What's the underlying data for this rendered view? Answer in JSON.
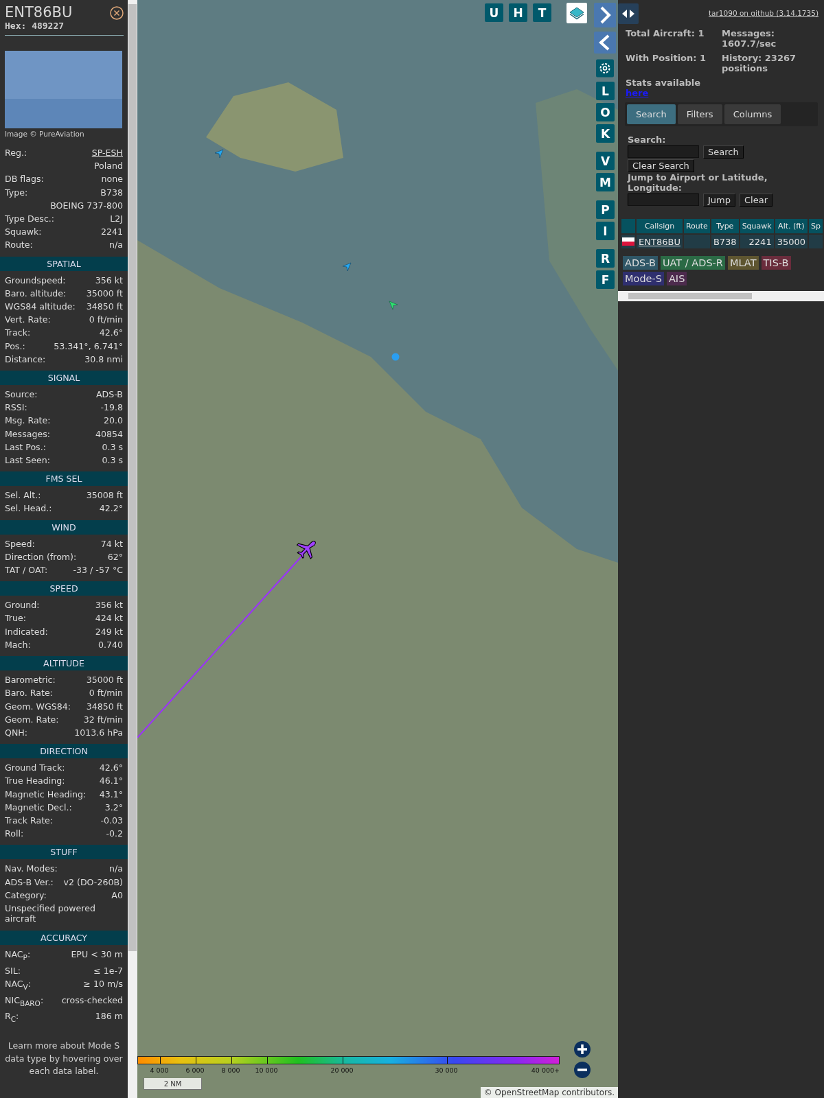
{
  "sidebar": {
    "callsign": "ENT86BU",
    "hex_label": "Hex:",
    "hex": "489227",
    "photo_credit": "Image © PureAviation",
    "summary": [
      {
        "kind": "link",
        "label": "Reg.:",
        "value": "SP-ESH"
      },
      {
        "kind": "value",
        "value": "Poland"
      },
      {
        "kind": "pair",
        "label": "DB flags:",
        "value": "none"
      },
      {
        "kind": "pair",
        "label": "Type:",
        "value": "B738"
      },
      {
        "kind": "value",
        "value": "BOEING 737-800"
      },
      {
        "kind": "pair",
        "label": "Type Desc.:",
        "value": "L2J"
      },
      {
        "kind": "pair",
        "label": "Squawk:",
        "value": "2241"
      },
      {
        "kind": "pair",
        "label": "Route:",
        "value": "n/a"
      }
    ],
    "sections": [
      {
        "title": "SPATIAL",
        "rows": [
          {
            "kind": "pair",
            "label": "Groundspeed:",
            "value": "356 kt"
          },
          {
            "kind": "pair",
            "label": "Baro. altitude:",
            "value": "35000 ft"
          },
          {
            "kind": "pair",
            "label": "WGS84 altitude:",
            "value": "34850 ft"
          },
          {
            "kind": "pair",
            "label": "Vert. Rate:",
            "value": "0 ft/min"
          },
          {
            "kind": "pair",
            "label": "Track:",
            "value": "42.6°"
          },
          {
            "kind": "pair",
            "label": "Pos.:",
            "value": "53.341°, 6.741°"
          },
          {
            "kind": "pair",
            "label": "Distance:",
            "value": "30.8 nmi"
          }
        ]
      },
      {
        "title": "SIGNAL",
        "rows": [
          {
            "kind": "pair",
            "label": "Source:",
            "value": "ADS-B"
          },
          {
            "kind": "pair",
            "label": "RSSI:",
            "value": "-19.8"
          },
          {
            "kind": "pair",
            "label": "Msg. Rate:",
            "value": "20.0"
          },
          {
            "kind": "pair",
            "label": "Messages:",
            "value": "40854"
          },
          {
            "kind": "pair",
            "label": "Last Pos.:",
            "value": "0.3 s"
          },
          {
            "kind": "pair",
            "label": "Last Seen:",
            "value": "0.3 s"
          }
        ]
      },
      {
        "title": "FMS SEL",
        "rows": [
          {
            "kind": "pair",
            "label": "Sel. Alt.:",
            "value": "35008 ft"
          },
          {
            "kind": "pair",
            "label": "Sel. Head.:",
            "value": "42.2°"
          }
        ]
      },
      {
        "title": "WIND",
        "rows": [
          {
            "kind": "pair",
            "label": "Speed:",
            "value": "74 kt"
          },
          {
            "kind": "pair",
            "label": "Direction (from):",
            "value": "62°"
          },
          {
            "kind": "pair",
            "label": "TAT / OAT:",
            "value": "-33 / -57 °C"
          }
        ]
      },
      {
        "title": "SPEED",
        "rows": [
          {
            "kind": "pair",
            "label": "Ground:",
            "value": "356 kt"
          },
          {
            "kind": "pair",
            "label": "True:",
            "value": "424 kt"
          },
          {
            "kind": "pair",
            "label": "Indicated:",
            "value": "249 kt"
          },
          {
            "kind": "pair",
            "label": "Mach:",
            "value": "0.740"
          }
        ]
      },
      {
        "title": "ALTITUDE",
        "rows": [
          {
            "kind": "pair",
            "label": "Barometric:",
            "value": "35000 ft"
          },
          {
            "kind": "pair",
            "label": "Baro. Rate:",
            "value": "0 ft/min"
          },
          {
            "kind": "pair",
            "label": "Geom. WGS84:",
            "value": "34850 ft"
          },
          {
            "kind": "pair",
            "label": "Geom. Rate:",
            "value": "32 ft/min"
          },
          {
            "kind": "pair",
            "label": "QNH:",
            "value": "1013.6 hPa"
          }
        ]
      },
      {
        "title": "DIRECTION",
        "rows": [
          {
            "kind": "pair",
            "label": "Ground Track:",
            "value": "42.6°"
          },
          {
            "kind": "pair",
            "label": "True Heading:",
            "value": "46.1°"
          },
          {
            "kind": "pair",
            "label": "Magnetic Heading:",
            "value": "43.1°"
          },
          {
            "kind": "pair",
            "label": "Magnetic Decl.:",
            "value": "3.2°"
          },
          {
            "kind": "pair",
            "label": "Track Rate:",
            "value": "-0.03"
          },
          {
            "kind": "pair",
            "label": "Roll:",
            "value": "-0.2"
          }
        ]
      },
      {
        "title": "STUFF",
        "rows": [
          {
            "kind": "pair",
            "label": "Nav. Modes:",
            "value": "n/a"
          },
          {
            "kind": "pair",
            "label": "ADS-B Ver.:",
            "value": "v2 (DO-260B)"
          },
          {
            "kind": "pair",
            "label": "Category:",
            "value": "A0"
          },
          {
            "kind": "note",
            "value": "Unspecified powered aircraft"
          }
        ]
      },
      {
        "title": "ACCURACY",
        "rows": [
          {
            "kind": "pair",
            "label": "NAC$_{P}$:",
            "value": "EPU < 30 m"
          },
          {
            "kind": "pair",
            "label": "SIL:",
            "value": "≤ 1e-7"
          },
          {
            "kind": "pair",
            "label": "NAC$_{V}$:",
            "value": "≥ 10 m/s"
          },
          {
            "kind": "pair",
            "label": "NIC$_{BARO}$:",
            "value": "cross-checked"
          },
          {
            "kind": "pair",
            "label": "R$_{C}$:",
            "value": "186 m"
          }
        ]
      }
    ],
    "footer": "Learn more about Mode S data type by hovering over each data label."
  },
  "map": {
    "top_buttons": [
      "U",
      "H",
      "T"
    ],
    "side_buttons": [
      "L",
      "O",
      "K",
      "V",
      "M",
      "P",
      "I",
      "R",
      "F"
    ],
    "altitude_legend": [
      "4 000",
      "6 000",
      "8 000",
      "10 000",
      "20 000",
      "30 000",
      "40 000+"
    ],
    "scale": "2 NM",
    "attribution_prefix": "©",
    "attribution_link": "OpenStreetMap",
    "attribution_suffix": "contributors."
  },
  "panel": {
    "github_link": "tar1090 on github (3.14.1735)",
    "stats": [
      {
        "label": "Total Aircraft:",
        "value": "1"
      },
      {
        "label": "Messages:",
        "value": "1607.7/sec"
      },
      {
        "label": "With Position:",
        "value": "1"
      },
      {
        "label": "History:",
        "value": "23267 positions"
      }
    ],
    "stats_note": "Stats available",
    "stats_link": "here",
    "tabs": [
      {
        "label": "Search",
        "selected": true
      },
      {
        "label": "Filters",
        "selected": false
      },
      {
        "label": "Columns",
        "selected": false
      }
    ],
    "search_label": "Search:",
    "search_button": "Search",
    "clear_search_button": "Clear Search",
    "jump_label": "Jump to Airport or Latitude, Longitude:",
    "jump_button": "Jump",
    "clear_button": "Clear",
    "table": {
      "columns": [
        "Callsign",
        "Route",
        "Type",
        "Squawk",
        "Alt. (ft)",
        "Sp"
      ],
      "rows": [
        {
          "callsign": "ENT86BU",
          "route": "",
          "type": "B738",
          "squawk": "2241",
          "altitude": "35000"
        }
      ]
    },
    "sources": [
      {
        "label": "ADS-B",
        "color": "#2f5666"
      },
      {
        "label": "UAT / ADS-R",
        "color": "#2b6a45"
      },
      {
        "label": "MLAT",
        "color": "#5e5530"
      },
      {
        "label": "TIS-B",
        "color": "#6a2c3c"
      },
      {
        "label": "Mode-S",
        "color": "#2f2f6e"
      },
      {
        "label": "AIS",
        "color": "#4d2b4d"
      }
    ]
  }
}
